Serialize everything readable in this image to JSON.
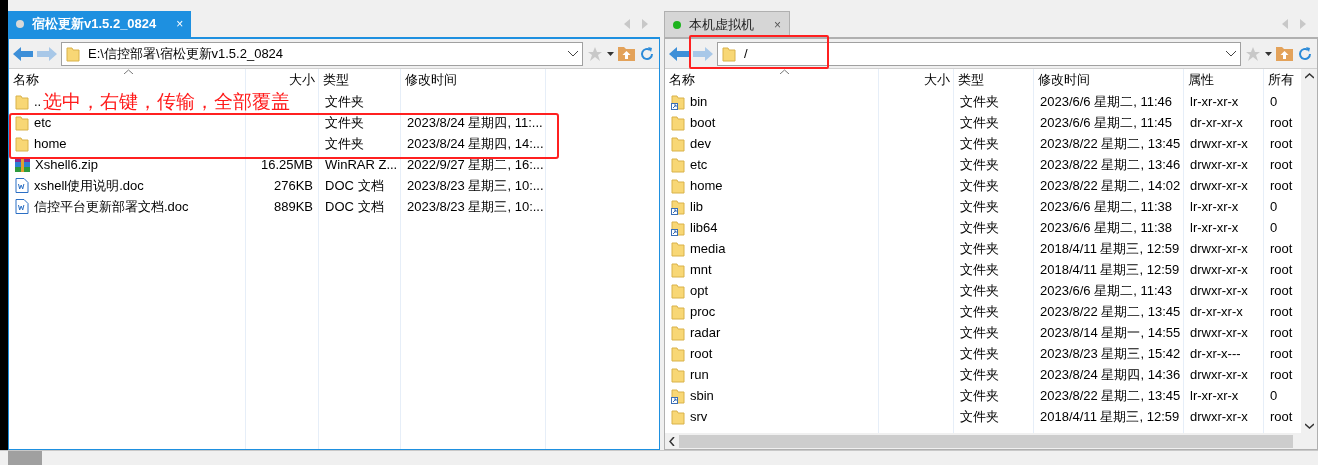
{
  "panes": [
    {
      "tab": {
        "title": "宿松更新v1.5.2_0824",
        "selected": true,
        "color": "#d9d9d9",
        "close": "×"
      },
      "path": {
        "value": "E:\\信控部署\\宿松更新v1.5.2_0824",
        "marked": false
      },
      "note": "选中，右键，传输，全部覆盖",
      "columns": [
        {
          "label": "名称",
          "kind": "name"
        },
        {
          "label": "大小",
          "kind": "size"
        },
        {
          "label": "类型",
          "kind": "text"
        },
        {
          "label": "修改时间",
          "kind": "text"
        }
      ],
      "rows": [
        {
          "kind": "folder",
          "marked": false,
          "cells": [
            "..",
            "",
            "文件夹",
            ""
          ]
        },
        {
          "kind": "folder",
          "marked": true,
          "cells": [
            "etc",
            "",
            "文件夹",
            "2023/8/24 星期四, 11:..."
          ]
        },
        {
          "kind": "folder",
          "marked": true,
          "cells": [
            "home",
            "",
            "文件夹",
            "2023/8/24 星期四, 14:..."
          ]
        },
        {
          "kind": "zip",
          "marked": false,
          "cells": [
            "Xshell6.zip",
            "16.25MB",
            "WinRAR Z...",
            "2022/9/27 星期二, 16:..."
          ]
        },
        {
          "kind": "doc",
          "marked": false,
          "cells": [
            "xshell使用说明.doc",
            "276KB",
            "DOC 文档",
            "2023/8/23 星期三, 10:..."
          ]
        },
        {
          "kind": "doc",
          "marked": false,
          "cells": [
            "信控平台更新部署文档.doc",
            "889KB",
            "DOC 文档",
            "2023/8/23 星期三, 10:..."
          ]
        }
      ]
    },
    {
      "tab": {
        "title": "本机虚拟机",
        "selected": false,
        "color": "#1db31d",
        "close": "×"
      },
      "path": {
        "value": "/",
        "marked": true
      },
      "columns": [
        {
          "label": "名称",
          "kind": "name"
        },
        {
          "label": "大小",
          "kind": "size"
        },
        {
          "label": "类型",
          "kind": "text"
        },
        {
          "label": "修改时间",
          "kind": "text"
        },
        {
          "label": "属性",
          "kind": "text"
        },
        {
          "label": "所有",
          "kind": "text"
        }
      ],
      "rows": [
        {
          "kind": "link",
          "marked": false,
          "cells": [
            "bin",
            "",
            "文件夹",
            "2023/6/6 星期二, 11:46",
            "lr-xr-xr-x",
            "0"
          ]
        },
        {
          "kind": "folder",
          "marked": false,
          "cells": [
            "boot",
            "",
            "文件夹",
            "2023/6/6 星期二, 11:45",
            "dr-xr-xr-x",
            "root"
          ]
        },
        {
          "kind": "folder",
          "marked": false,
          "cells": [
            "dev",
            "",
            "文件夹",
            "2023/8/22 星期二, 13:45",
            "drwxr-xr-x",
            "root"
          ]
        },
        {
          "kind": "folder",
          "marked": false,
          "cells": [
            "etc",
            "",
            "文件夹",
            "2023/8/22 星期二, 13:46",
            "drwxr-xr-x",
            "root"
          ]
        },
        {
          "kind": "folder",
          "marked": false,
          "cells": [
            "home",
            "",
            "文件夹",
            "2023/8/22 星期二, 14:02",
            "drwxr-xr-x",
            "root"
          ]
        },
        {
          "kind": "link",
          "marked": false,
          "cells": [
            "lib",
            "",
            "文件夹",
            "2023/6/6 星期二, 11:38",
            "lr-xr-xr-x",
            "0"
          ]
        },
        {
          "kind": "link",
          "marked": false,
          "cells": [
            "lib64",
            "",
            "文件夹",
            "2023/6/6 星期二, 11:38",
            "lr-xr-xr-x",
            "0"
          ]
        },
        {
          "kind": "folder",
          "marked": false,
          "cells": [
            "media",
            "",
            "文件夹",
            "2018/4/11 星期三, 12:59",
            "drwxr-xr-x",
            "root"
          ]
        },
        {
          "kind": "folder",
          "marked": false,
          "cells": [
            "mnt",
            "",
            "文件夹",
            "2018/4/11 星期三, 12:59",
            "drwxr-xr-x",
            "root"
          ]
        },
        {
          "kind": "folder",
          "marked": false,
          "cells": [
            "opt",
            "",
            "文件夹",
            "2023/6/6 星期二, 11:43",
            "drwxr-xr-x",
            "root"
          ]
        },
        {
          "kind": "folder",
          "marked": false,
          "cells": [
            "proc",
            "",
            "文件夹",
            "2023/8/22 星期二, 13:45",
            "dr-xr-xr-x",
            "root"
          ]
        },
        {
          "kind": "folder",
          "marked": false,
          "cells": [
            "radar",
            "",
            "文件夹",
            "2023/8/14 星期一, 14:55",
            "drwxr-xr-x",
            "root"
          ]
        },
        {
          "kind": "folder",
          "marked": false,
          "cells": [
            "root",
            "",
            "文件夹",
            "2023/8/23 星期三, 15:42",
            "dr-xr-x---",
            "root"
          ]
        },
        {
          "kind": "folder",
          "marked": false,
          "cells": [
            "run",
            "",
            "文件夹",
            "2023/8/24 星期四, 14:36",
            "drwxr-xr-x",
            "root"
          ]
        },
        {
          "kind": "link",
          "marked": false,
          "cells": [
            "sbin",
            "",
            "文件夹",
            "2023/8/22 星期二, 13:45",
            "lr-xr-xr-x",
            "0"
          ]
        },
        {
          "kind": "folder",
          "marked": false,
          "cells": [
            "srv",
            "",
            "文件夹",
            "2018/4/11 星期三, 12:59",
            "drwxr-xr-x",
            "root"
          ]
        }
      ]
    }
  ]
}
